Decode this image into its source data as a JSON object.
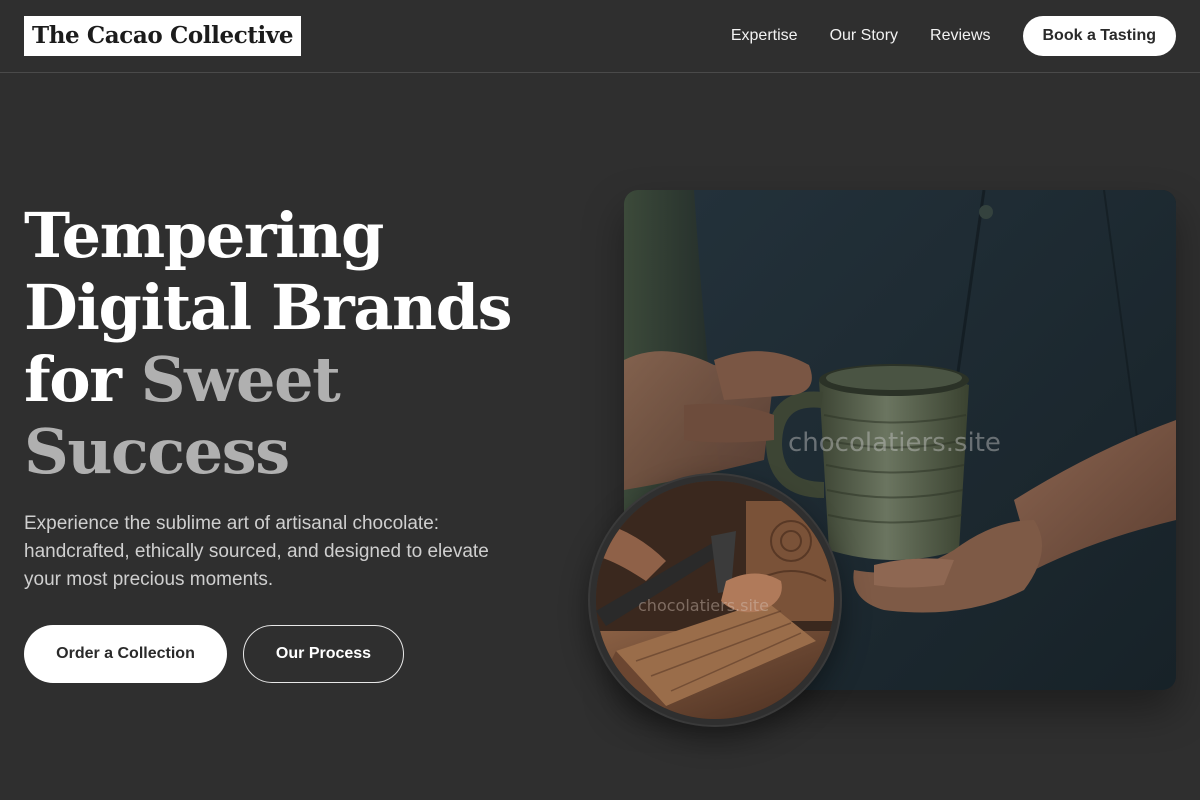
{
  "header": {
    "logo": "The Cacao Collective",
    "nav": [
      "Expertise",
      "Our Story",
      "Reviews"
    ],
    "cta": "Book a Tasting"
  },
  "hero": {
    "title_line1": "Tempering",
    "title_line2": "Digital Brands",
    "title_line3_start": "for ",
    "title_line3_accent": "Sweet",
    "title_line4_accent": "Success",
    "description": "Experience the sublime art of artisanal chocolate: handcrafted, ethically sourced, and designed to elevate your most precious moments.",
    "primary_button": "Order a Collection",
    "secondary_button": "Our Process"
  },
  "images": {
    "main_alt": "Hands holding a ceramic mug in front of a dark apron",
    "main_watermark": "chocolatiers.site",
    "circle_alt": "Craftsman carving wood with a chisel",
    "circle_watermark": "chocolatiers.site"
  },
  "colors": {
    "background": "#2f2f2f",
    "accent_text": "#b0b0b0",
    "button_bg": "#ffffff"
  }
}
